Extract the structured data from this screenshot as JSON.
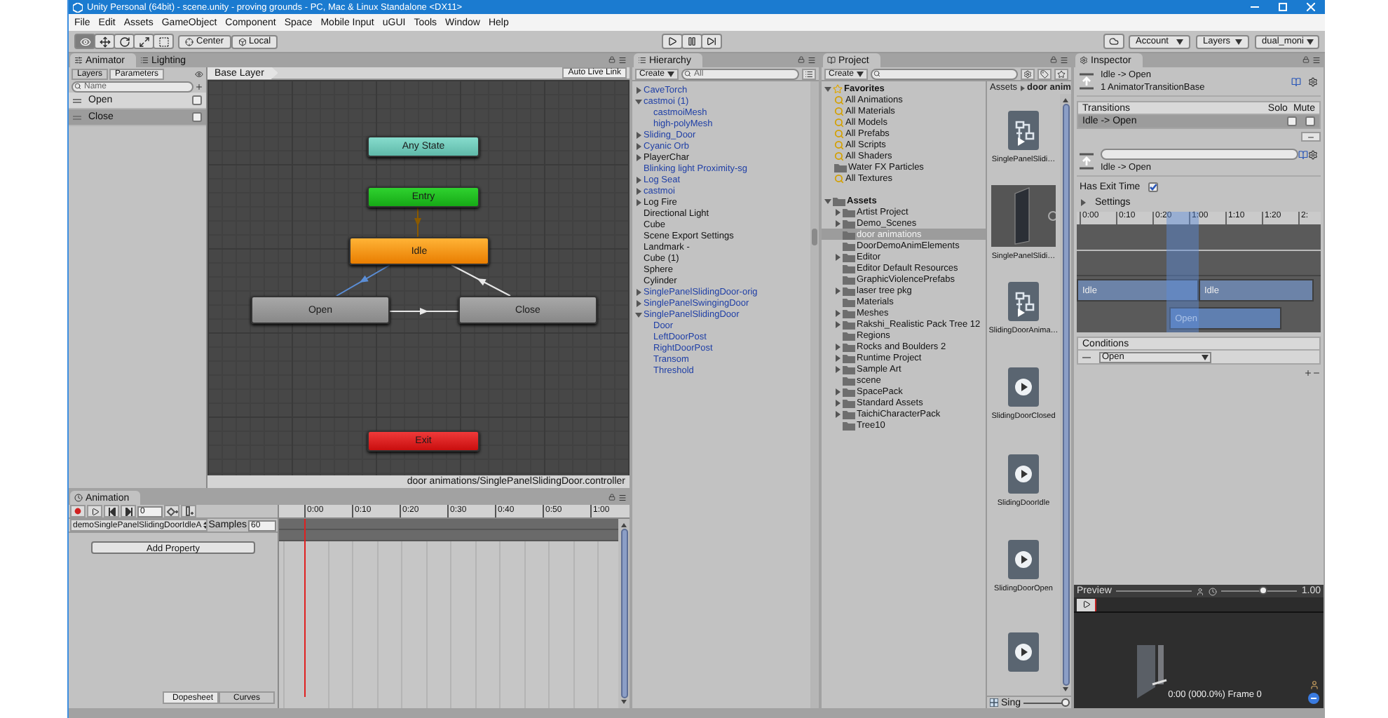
{
  "window": {
    "title": "Unity Personal (64bit) - scene.unity - proving grounds - PC, Mac & Linux Standalone <DX11>"
  },
  "menu": [
    "File",
    "Edit",
    "Assets",
    "GameObject",
    "Component",
    "Space",
    "Mobile Input",
    "uGUI",
    "Tools",
    "Window",
    "Help"
  ],
  "toolbar": {
    "tools": [
      {
        "kind": "view",
        "selected": true
      },
      {
        "kind": "move",
        "selected": false
      },
      {
        "kind": "rotate",
        "selected": false
      },
      {
        "kind": "scale",
        "selected": false
      },
      {
        "kind": "rect",
        "selected": false
      }
    ],
    "pivot": [
      "Center",
      "Local"
    ],
    "play": [
      {
        "kind": "play",
        "selected": false
      },
      {
        "kind": "pause",
        "selected": false
      },
      {
        "kind": "step",
        "selected": false
      }
    ],
    "account": "Account",
    "layers": "Layers",
    "layout": "dual_moni"
  },
  "animator": {
    "tabs": [
      {
        "label": "Animator",
        "selected": true
      },
      {
        "label": "Lighting",
        "selected": false
      }
    ],
    "subtabs": [
      {
        "label": "Layers",
        "selected": false
      },
      {
        "label": "Parameters",
        "selected": true
      }
    ],
    "search": {
      "placeholder": "Name"
    },
    "parameters": [
      {
        "name": "Open",
        "checked": false,
        "selected": false
      },
      {
        "name": "Close",
        "checked": false,
        "selected": true
      }
    ],
    "breadcrumb": "Base Layer",
    "live_link": "Auto Live Link",
    "nodes": [
      {
        "label": "Any State",
        "kind": "any"
      },
      {
        "label": "Entry",
        "kind": "entry"
      },
      {
        "label": "Idle",
        "kind": "default"
      },
      {
        "label": "Open",
        "kind": "state"
      },
      {
        "label": "Close",
        "kind": "state"
      },
      {
        "label": "Exit",
        "kind": "exit"
      }
    ],
    "path": "door animations/SinglePanelSlidingDoor.controller"
  },
  "animation": {
    "tab": "Animation",
    "frame": "0",
    "clip": "demoSinglePanelSlidingDoorIdleA",
    "samples_label": "Samples",
    "samples": "60",
    "add_property": "Add Property",
    "ticks": [
      "0:00",
      "0:10",
      "0:20",
      "0:30",
      "0:40",
      "0:50",
      "1:00"
    ],
    "views": [
      {
        "label": "Dopesheet",
        "selected": true
      },
      {
        "label": "Curves",
        "selected": false
      }
    ]
  },
  "hierarchy": {
    "title": "Hierarchy",
    "create": "Create",
    "search": {
      "placeholder": "All"
    },
    "items": [
      {
        "label": "CaveTorch",
        "kind": "prefab",
        "expanded": false
      },
      {
        "label": "castmoi (1)",
        "kind": "prefab",
        "expanded": true,
        "children": [
          {
            "label": "castmoiMesh",
            "kind": "prefab"
          },
          {
            "label": "high-polyMesh",
            "kind": "prefab"
          }
        ]
      },
      {
        "label": "Sliding_Door",
        "kind": "prefab",
        "expanded": false
      },
      {
        "label": "Cyanic Orb",
        "kind": "prefab",
        "expanded": false
      },
      {
        "label": "PlayerChar",
        "kind": "object",
        "expanded": false
      },
      {
        "label": "Blinking light Proximity-sg",
        "kind": "prefab"
      },
      {
        "label": "Log Seat",
        "kind": "prefab",
        "expanded": false
      },
      {
        "label": "castmoi",
        "kind": "prefab",
        "expanded": false
      },
      {
        "label": "Log Fire",
        "kind": "object",
        "expanded": false
      },
      {
        "label": "Directional Light",
        "kind": "object"
      },
      {
        "label": "Cube",
        "kind": "object"
      },
      {
        "label": "Scene Export Settings",
        "kind": "object"
      },
      {
        "label": "Landmark -",
        "kind": "object"
      },
      {
        "label": "Cube (1)",
        "kind": "object"
      },
      {
        "label": "Sphere",
        "kind": "object"
      },
      {
        "label": "Cylinder",
        "kind": "object"
      },
      {
        "label": "SinglePanelSlidingDoor-orig",
        "kind": "prefab",
        "expanded": false
      },
      {
        "label": "SinglePanelSwingingDoor",
        "kind": "prefab",
        "expanded": false
      },
      {
        "label": "SinglePanelSlidingDoor",
        "kind": "prefab",
        "expanded": true,
        "children": [
          {
            "label": "Door",
            "kind": "prefab"
          },
          {
            "label": "LeftDoorPost",
            "kind": "prefab"
          },
          {
            "label": "RightDoorPost",
            "kind": "prefab"
          },
          {
            "label": "Transom",
            "kind": "prefab"
          },
          {
            "label": "Threshold",
            "kind": "prefab"
          }
        ]
      }
    ]
  },
  "project": {
    "title": "Project",
    "create": "Create",
    "favorites": {
      "label": "Favorites",
      "expanded": true,
      "items": [
        {
          "label": "All Animations",
          "kind": "search"
        },
        {
          "label": "All Materials",
          "kind": "search"
        },
        {
          "label": "All Models",
          "kind": "search"
        },
        {
          "label": "All Prefabs",
          "kind": "search"
        },
        {
          "label": "All Scripts",
          "kind": "search"
        },
        {
          "label": "All Shaders",
          "kind": "search"
        },
        {
          "label": "Water FX Particles",
          "kind": "folder"
        },
        {
          "label": "All Textures",
          "kind": "search"
        }
      ]
    },
    "assets": {
      "label": "Assets",
      "expanded": true,
      "children": [
        {
          "label": "Artist Project",
          "expanded": false,
          "selected": false
        },
        {
          "label": "Demo_Scenes",
          "expanded": false,
          "selected": false
        },
        {
          "label": "door animations",
          "selected": true
        },
        {
          "label": "DoorDemoAnimElements",
          "selected": false
        },
        {
          "label": "Editor",
          "expanded": false,
          "selected": false
        },
        {
          "label": "Editor Default Resources",
          "selected": false
        },
        {
          "label": "GraphicViolencePrefabs",
          "selected": false
        },
        {
          "label": "laser tree pkg",
          "expanded": false,
          "selected": false
        },
        {
          "label": "Materials",
          "selected": false
        },
        {
          "label": "Meshes",
          "expanded": false,
          "selected": false
        },
        {
          "label": "Rakshi_Realistic Pack Tree 12",
          "expanded": false,
          "selected": false
        },
        {
          "label": "Regions",
          "selected": false
        },
        {
          "label": "Rocks and Boulders 2",
          "expanded": false,
          "selected": false
        },
        {
          "label": "Runtime Project",
          "expanded": false,
          "selected": false
        },
        {
          "label": "Sample Art",
          "expanded": false,
          "selected": false
        },
        {
          "label": "scene",
          "selected": false
        },
        {
          "label": "SpacePack",
          "expanded": false,
          "selected": false
        },
        {
          "label": "Standard Assets",
          "expanded": false,
          "selected": false
        },
        {
          "label": "TaichiCharacterPack",
          "expanded": false,
          "selected": false
        },
        {
          "label": "Tree10",
          "selected": false
        }
      ]
    },
    "breadcrumb": [
      "Assets",
      "door anim"
    ],
    "files": [
      {
        "label": "SinglePanelSlidi…",
        "kind": "controller"
      },
      {
        "label": "SinglePanelSlidi…",
        "kind": "model"
      },
      {
        "label": "SlidingDoorAnima…",
        "kind": "controller"
      },
      {
        "label": "SlidingDoorClosed",
        "kind": "clip"
      },
      {
        "label": "SlidingDoorIdle",
        "kind": "clip"
      },
      {
        "label": "SlidingDoorOpen",
        "kind": "clip"
      },
      {
        "kind": "clip"
      }
    ],
    "zoom_slider": {
      "label": "Sing",
      "level": 0.95
    }
  },
  "inspector": {
    "title": "Inspector",
    "header": {
      "title": "Idle -> Open",
      "subtitle": "1 AnimatorTransitionBase"
    },
    "transitions": {
      "label": "Transitions",
      "columns": [
        "Solo",
        "Mute"
      ],
      "rows": [
        {
          "label": "Idle -> Open",
          "selected": true,
          "solo": false,
          "mute": false
        }
      ]
    },
    "transition": {
      "label": "Idle -> Open"
    },
    "has_exit_time": {
      "label": "Has Exit Time",
      "checked": true
    },
    "settings": {
      "label": "Settings",
      "expanded": false
    },
    "timeline": {
      "ticks": [
        "0:00",
        "0:10",
        "0:20",
        "1:00",
        "1:10",
        "1:20",
        "2:"
      ],
      "tracks": [
        {
          "label": "Idle"
        },
        {
          "label": "Idle"
        },
        {
          "label": "Open"
        }
      ]
    },
    "conditions": {
      "label": "Conditions",
      "rows": [
        {
          "value": "Open"
        }
      ]
    },
    "preview": {
      "label": "Preview",
      "speed": {
        "level": 0.55
      },
      "speed_reading": "1.00",
      "status": "0:00 (000.0%) Frame 0"
    }
  }
}
